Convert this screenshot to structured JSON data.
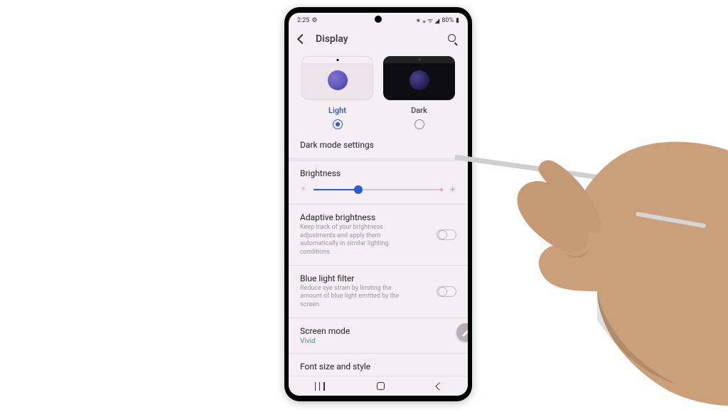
{
  "status": {
    "time": "2:25",
    "battery": "80%",
    "icons": "✱ ⋮ ⁴ᴳ ▲"
  },
  "header": {
    "title": "Display"
  },
  "theme": {
    "light_label": "Light",
    "dark_label": "Dark",
    "selected": "light"
  },
  "dark_mode_settings": "Dark mode settings",
  "brightness": {
    "label": "Brightness",
    "value_pct": 35
  },
  "adaptive": {
    "title": "Adaptive brightness",
    "sub": "Keep track of your brightness adjustments and apply them automatically in similar lighting conditions.",
    "on": false
  },
  "bluelight": {
    "title": "Blue light filter",
    "sub": "Reduce eye strain by limiting the amount of blue light emitted by the screen.",
    "on": false
  },
  "screen_mode": {
    "title": "Screen mode",
    "value": "Vivid"
  },
  "font": {
    "title": "Font size and style"
  }
}
